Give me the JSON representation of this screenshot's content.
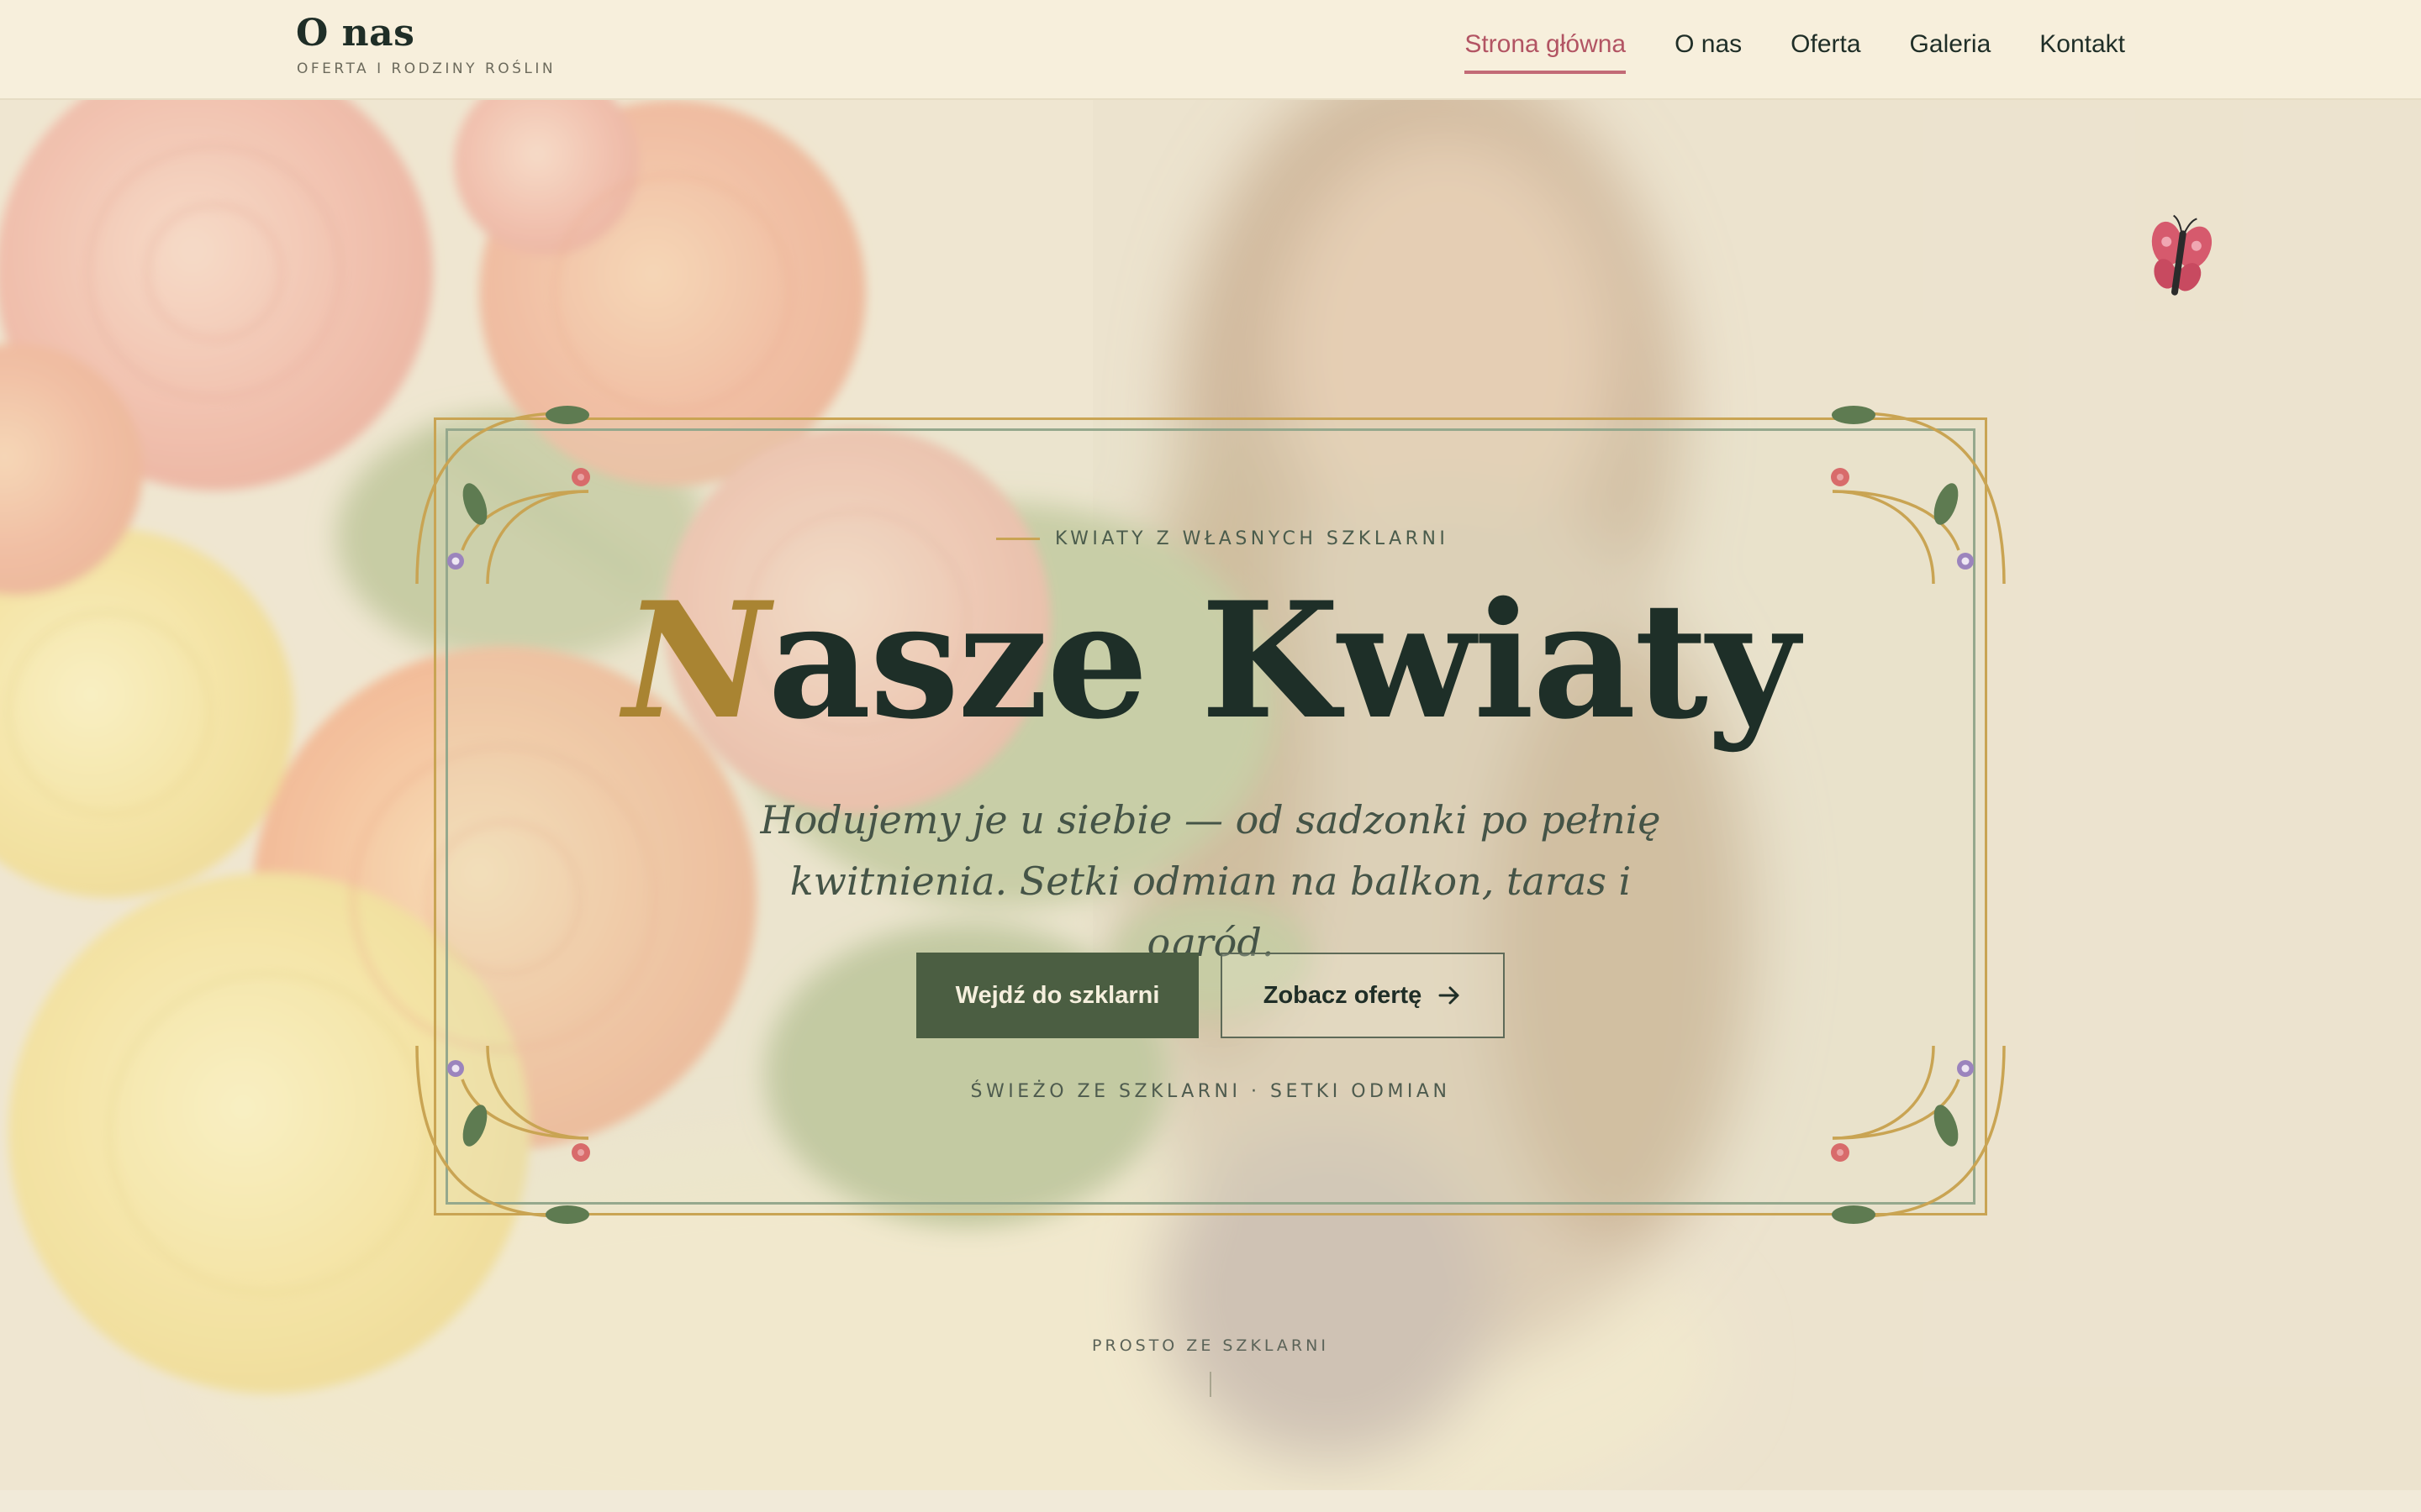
{
  "header": {
    "brand_title": "O nas",
    "brand_subtitle": "OFERTA I RODZINY ROŚLIN",
    "nav": [
      {
        "label": "Strona główna",
        "active": true
      },
      {
        "label": "O nas",
        "active": false
      },
      {
        "label": "Oferta",
        "active": false
      },
      {
        "label": "Galeria",
        "active": false
      },
      {
        "label": "Kontakt",
        "active": false
      }
    ]
  },
  "hero": {
    "eyebrow": "KWIATY Z WŁASNYCH SZKLARNI",
    "title_first_letter": "N",
    "title_rest": "asze Kwiaty",
    "subtitle": "Hodujemy je u siebie — od sadzonki po pełnię kwitnienia. Setki odmian na balkon, taras i ogród.",
    "primary_button": "Wejdź do szklarni",
    "secondary_button": "Zobacz ofertę",
    "tagline": "ŚWIEŻO ZE SZKLARNI · SETKI ODMIAN",
    "scroll_label": "PROSTO ZE SZKLARNI"
  },
  "colors": {
    "accent_rose": "#b25463",
    "accent_gold": "#c9a453",
    "button_green": "#4b5e42",
    "text_dark": "#1e2f28"
  },
  "icons": [
    "arrow-right-icon",
    "butterfly-icon",
    "corner-ornament-icon"
  ]
}
